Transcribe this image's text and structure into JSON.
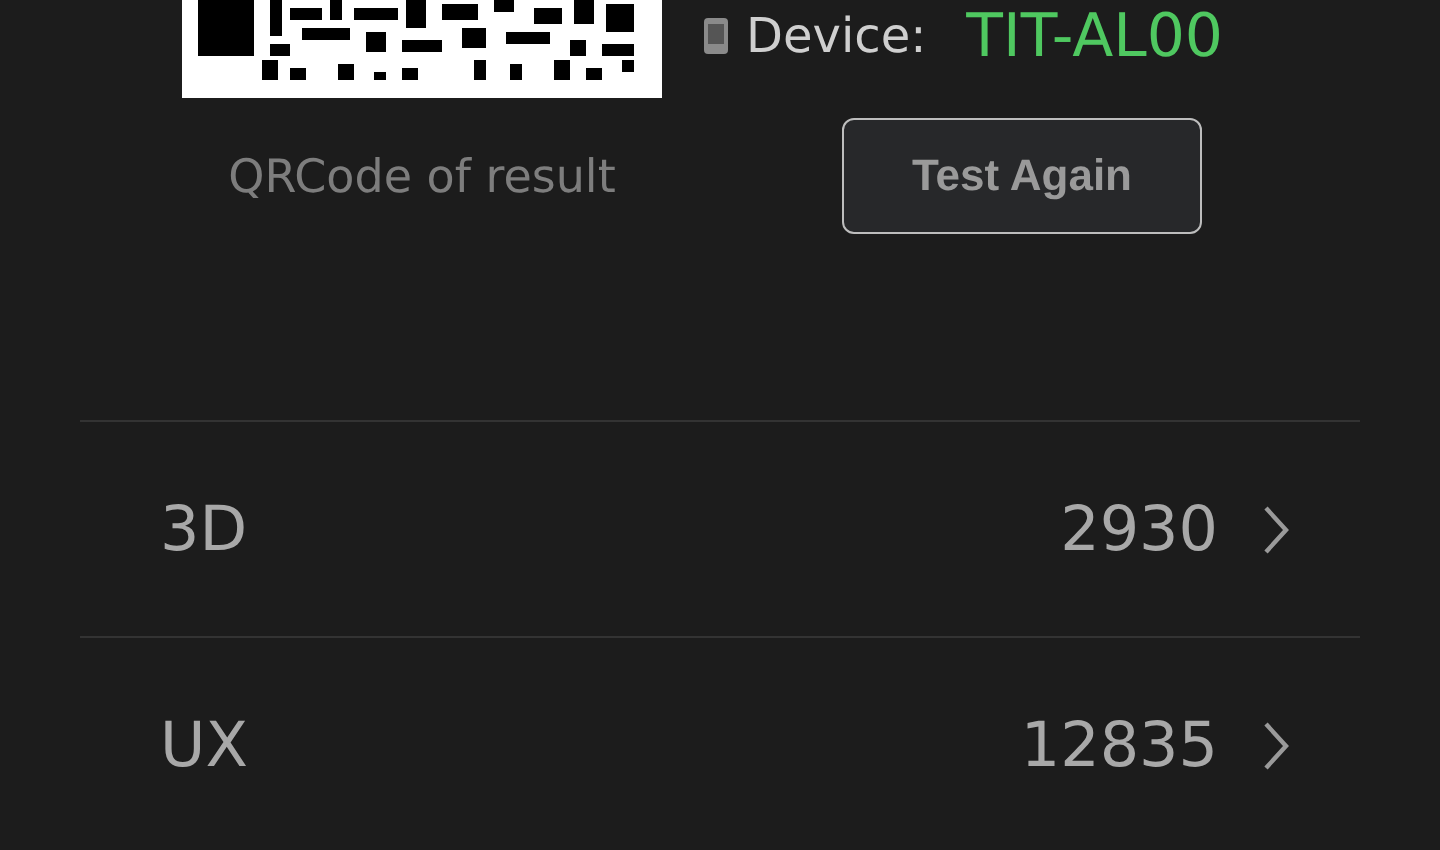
{
  "device": {
    "label": "Device:",
    "value": "TIT-AL00"
  },
  "qr_caption": "QRCode of result",
  "test_again_button": "Test Again",
  "scores": [
    {
      "name": "3D",
      "value": "2930"
    },
    {
      "name": "UX",
      "value": "12835"
    }
  ]
}
